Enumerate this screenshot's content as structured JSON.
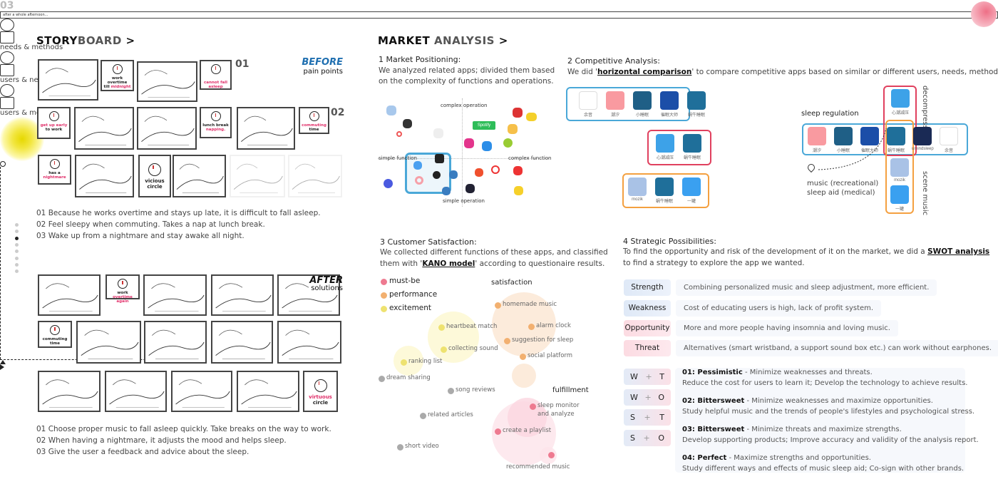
{
  "storyboard": {
    "title_a": "STORY",
    "title_b": "BOARD",
    "chevron": ">",
    "before": {
      "label": "BEFORE",
      "sub": "pain points",
      "nums": [
        "01",
        "02",
        "03"
      ],
      "captions": [
        {
          "a": "work overtime",
          "b": "till ",
          "r": "midnight"
        },
        {
          "a": "",
          "b": "",
          "r": "cannot fall asleep"
        },
        {
          "a": "",
          "b": "to work",
          "r": "get up early"
        },
        {
          "a": "lunch break",
          "b": "",
          "r": "napping."
        },
        {
          "a": "",
          "b": "time",
          "r": "commuting "
        },
        {
          "a": "has a",
          "b": "",
          "r": "nightmare"
        },
        {
          "a": "vicious",
          "b": "circle",
          "r": ""
        }
      ],
      "bubble": "after a whole afternoon...",
      "lines": [
        "01 Because he works overtime and stays up late, it is difficult to fall asleep.",
        "02 Feel sleepy when commuting. Takes a nap at lunch break.",
        "03 Wake up from a nightmare and stay awake all night."
      ]
    },
    "after": {
      "label": "AFTER",
      "sub": "solutions",
      "captions": [
        {
          "a": "work",
          "b": "",
          "r": "overtime again"
        },
        {
          "a": "commuting time",
          "b": "",
          "r": ""
        },
        {
          "a": "",
          "b": "circle",
          "r": "virtuous"
        }
      ],
      "lines": [
        "01 Choose proper music to fall asleep quickly. Take breaks on the way to work.",
        "02 When having a nightmare, it adjusts the mood and helps sleep.",
        "03 Give the user a feedback and advice about the sleep."
      ]
    },
    "page_dots": 8,
    "active_dot": 3
  },
  "market": {
    "title_a": "MARKET",
    "title_b": "ANALYSIS",
    "chevron": ">",
    "positioning": {
      "heading": "1 Market Positioning:",
      "text": [
        "We analyzed related apps; divided them based",
        "on the complexity of functions and operations."
      ],
      "axes": {
        "top": "complex operation",
        "bottom": "simple operation",
        "left": "simple function",
        "right": "complex function"
      },
      "spotify": "Spotify"
    },
    "competitive": {
      "heading": "2 Competitive Analysis:",
      "text_pre": "We did '",
      "text_link": "horizontal comparison",
      "text_post": "' to compare competitive apps based on similar or different users, needs, methods.",
      "groups": [
        {
          "apps": [
            "余音",
            "潮汐",
            "小睡眠",
            "催眠大师",
            "蜗牛睡眠"
          ],
          "label": "needs & methods",
          "color": "#4aa8d8"
        },
        {
          "apps": [
            "心潮减压",
            "蜗牛睡眠"
          ],
          "label": "users & needs",
          "color": "#e0405e"
        },
        {
          "apps": [
            "mozik",
            "蜗牛睡眠",
            "一罐"
          ],
          "label": "users & methods",
          "color": "#f4a040"
        }
      ],
      "map": {
        "row_label": "sleep regulation",
        "row_apps": [
          "潮汐",
          "小睡眠",
          "催眠大师",
          "蜗牛睡眠",
          "umindsleep",
          "余音"
        ],
        "top_app": "心潮减压",
        "bottom_apps": [
          "mozik",
          "一罐"
        ],
        "vertical_top": "decompression",
        "vertical_bottom": "scene music",
        "pin_lines": [
          "music (recreational)",
          "sleep aid (medical)"
        ]
      }
    },
    "satisfaction": {
      "heading": "3 Customer Satisfaction:",
      "text_a": "We collected different functions of these apps, and classified",
      "text_pre": "them with '",
      "text_link": "KANO model",
      "text_post": "' according to questionaire results.",
      "legend": [
        {
          "label": "must-be",
          "color": "#ee7a90"
        },
        {
          "label": "performance",
          "color": "#f2b070"
        },
        {
          "label": "excitement",
          "color": "#eee270"
        }
      ],
      "y_axis": "satisfaction",
      "x_axis": "fulfillment",
      "points": [
        {
          "label": "homemade music",
          "cat": "performance"
        },
        {
          "label": "alarm clock",
          "cat": "performance"
        },
        {
          "label": "suggestion for sleep",
          "cat": "performance"
        },
        {
          "label": "social platform",
          "cat": "performance"
        },
        {
          "label": "heartbeat match",
          "cat": "excitement"
        },
        {
          "label": "collecting sound",
          "cat": "excitement"
        },
        {
          "label": "ranking list",
          "cat": "excitement"
        },
        {
          "label": "dream sharing",
          "cat": "indifferent"
        },
        {
          "label": "song reviews",
          "cat": "indifferent"
        },
        {
          "label": "related articles",
          "cat": "indifferent"
        },
        {
          "label": "short video",
          "cat": "indifferent"
        },
        {
          "label": "sleep monitor",
          "label2": "and analyze",
          "cat": "must-be"
        },
        {
          "label": "create a playlist",
          "cat": "must-be"
        },
        {
          "label": "recommended music",
          "cat": "must-be"
        }
      ]
    },
    "strategy": {
      "heading": "4 Strategic Possibilities:",
      "text_pre": "To find the opportunity and risk of the development of it on the market, we did a ",
      "text_link": "SWOT analysis",
      "text_b": "to find a strategy to explore the app we wanted.",
      "swot": [
        {
          "label": "Strength",
          "desc": "Combining personalized music and sleep adjustment, more efficient."
        },
        {
          "label": "Weakness",
          "desc": "Cost of educating users is high, lack of profit system."
        },
        {
          "label": "Opportunity",
          "desc": "More and more people having insomnia and loving music."
        },
        {
          "label": "Threat",
          "desc": "Alternatives (smart wristband, a support sound box etc.) can work without earphones."
        }
      ],
      "combos": [
        {
          "a": "W",
          "b": "T"
        },
        {
          "a": "W",
          "b": "O"
        },
        {
          "a": "S",
          "b": "T"
        },
        {
          "a": "S",
          "b": "O"
        }
      ],
      "plus": "+",
      "strategies": [
        {
          "title": "01: Pessimistic",
          "line1": " - Minimize weaknesses and threats.",
          "line2": "Reduce the cost for users to learn it; Develop the technology to achieve results."
        },
        {
          "title": "02: Bittersweet",
          "line1": " - Minimize weaknesses and maximize opportunities.",
          "line2": "Study helpful music and the trends of people's lifestyles and psychological stress."
        },
        {
          "title": "03: Bittersweet",
          "line1": " - Minimize threats and maximize strengths.",
          "line2": "Develop supporting products; Improve accuracy and validity of the analysis report."
        },
        {
          "title": "04: Perfect",
          "line1": " - Maximize strengths and opportunities.",
          "line2": "Study different ways and effects of music sleep aid; Co-sign with other brands."
        }
      ]
    }
  },
  "colors": {
    "accent_blue": "#1f6fb0",
    "pink": "#e0306a",
    "blue_box": "#4aa8d8",
    "red_box": "#e0405e",
    "orange_box": "#f4a040"
  }
}
